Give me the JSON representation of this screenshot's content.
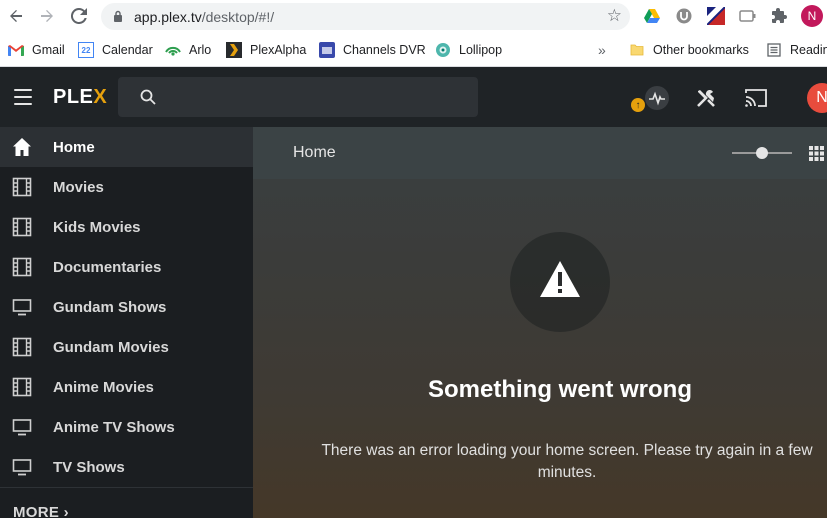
{
  "browser": {
    "url_host": "app.plex.tv",
    "url_path": "/desktop/#!/",
    "profile_initial": "N"
  },
  "bookmarks": [
    {
      "label": "Gmail",
      "icon": "gmail-icon"
    },
    {
      "label": "Calendar",
      "icon": "calendar-icon",
      "icon_text": "22"
    },
    {
      "label": "Arlo",
      "icon": "arlo-icon"
    },
    {
      "label": "PlexAlpha",
      "icon": "plex-icon"
    },
    {
      "label": "Channels DVR",
      "icon": "channels-icon"
    },
    {
      "label": "Lollipop",
      "icon": "lollipop-icon"
    }
  ],
  "bookmarks_overflow": "»",
  "other_bookmarks": "Other bookmarks",
  "reading_list": "Readin",
  "plex": {
    "logo_main": "PLE",
    "logo_x": "X",
    "avatar_initial": "N",
    "upload_badge": "↑"
  },
  "sidebar": {
    "items": [
      {
        "label": "Home",
        "icon": "home-icon"
      },
      {
        "label": "Movies",
        "icon": "film-icon"
      },
      {
        "label": "Kids Movies",
        "icon": "film-icon"
      },
      {
        "label": "Documentaries",
        "icon": "film-icon"
      },
      {
        "label": "Gundam Shows",
        "icon": "tv-icon"
      },
      {
        "label": "Gundam Movies",
        "icon": "film-icon"
      },
      {
        "label": "Anime Movies",
        "icon": "film-icon"
      },
      {
        "label": "Anime TV Shows",
        "icon": "tv-icon"
      },
      {
        "label": "TV Shows",
        "icon": "tv-icon"
      }
    ],
    "more": "MORE ›"
  },
  "main": {
    "title": "Home",
    "slider_value": 0.5,
    "error_title": "Something went wrong",
    "error_message": "There was an error loading your home screen. Please try again in a few minutes."
  },
  "colors": {
    "plex_accent": "#e5a00d",
    "topbar": "#1f2326",
    "sidebar": "#1b1e21"
  }
}
